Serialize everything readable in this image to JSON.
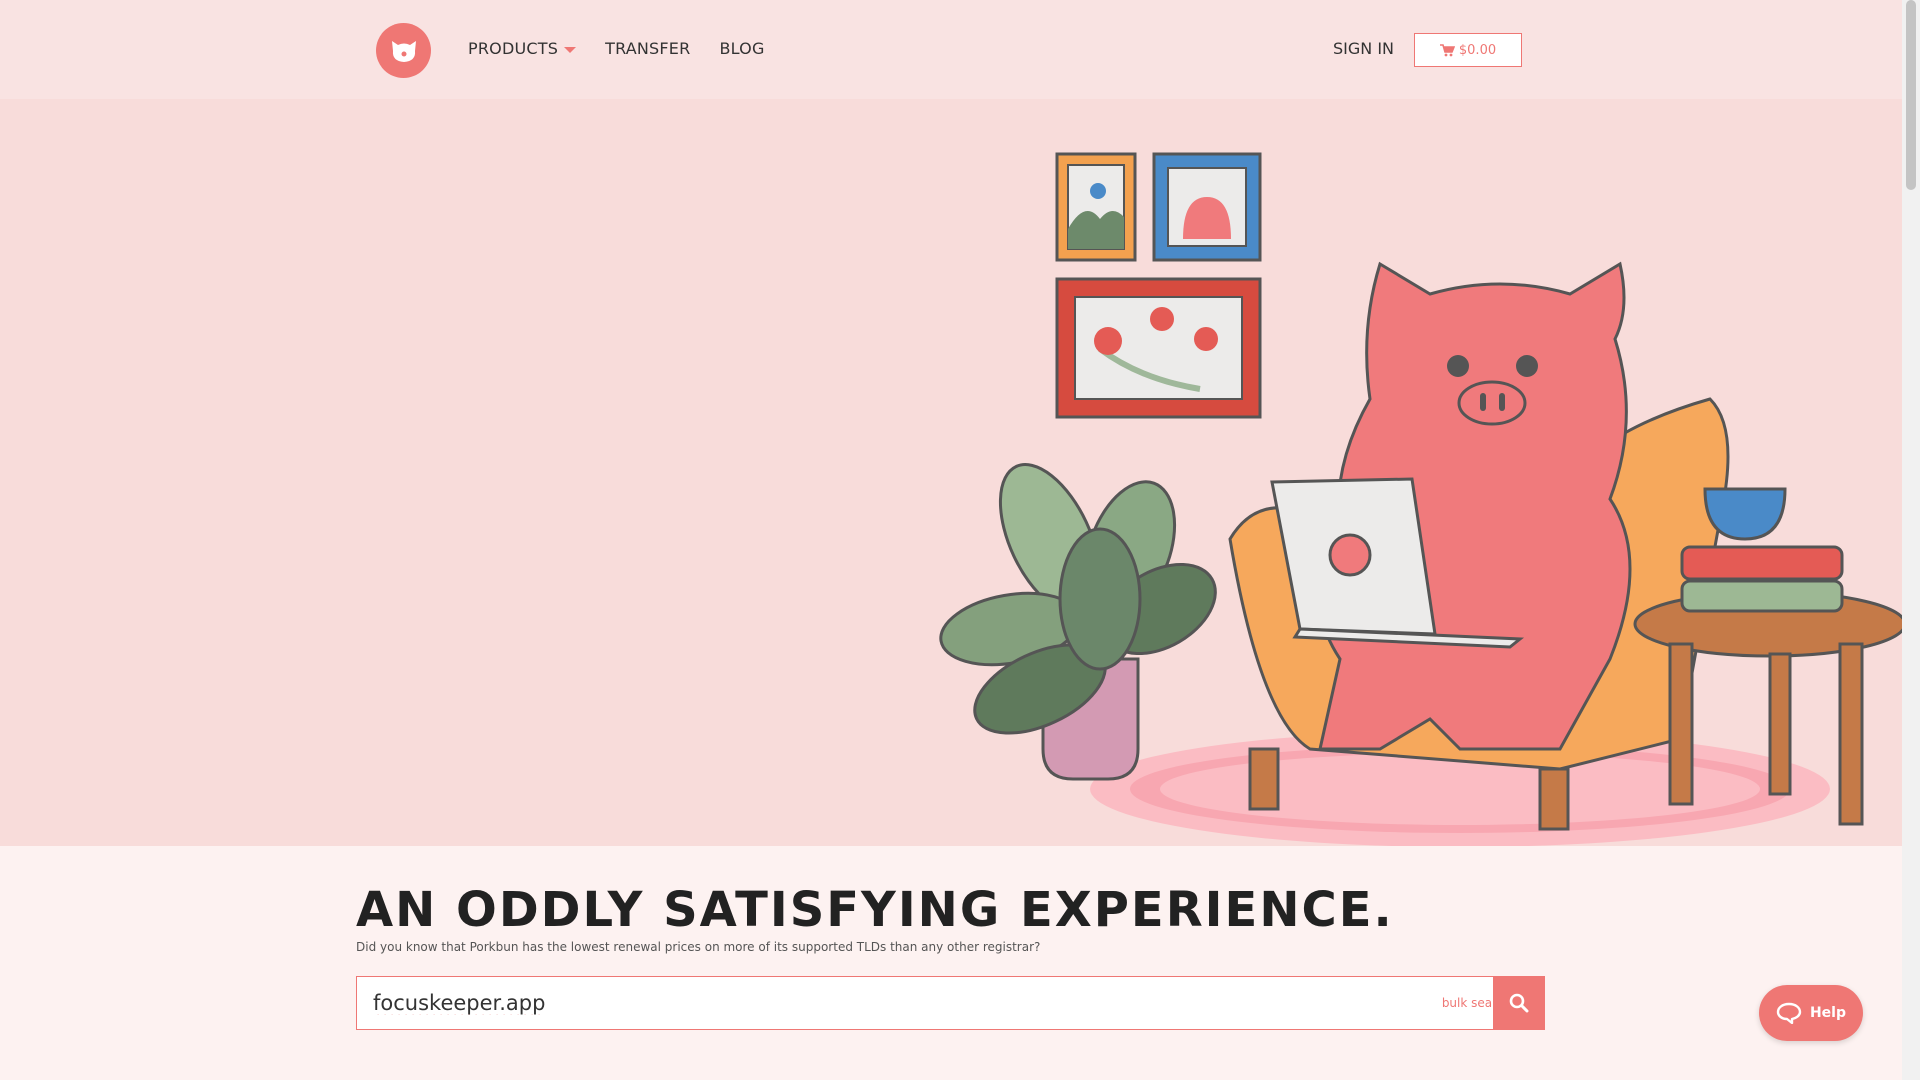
{
  "header": {
    "nav": [
      {
        "label": "PRODUCTS"
      },
      {
        "label": "TRANSFER"
      },
      {
        "label": "BLOG"
      }
    ],
    "sign_in": "SIGN IN",
    "cart_total": "$0.00"
  },
  "main": {
    "headline": "AN ODDLY SATISFYING EXPERIENCE.",
    "subline": "Did you know that Porkbun has the lowest renewal prices on more of its supported TLDs than any other registrar?",
    "search_value": "focuskeeper.app",
    "bulk_search_label": "bulk search"
  },
  "help": {
    "label": "Help"
  },
  "colors": {
    "accent": "#ef7774",
    "header_bg": "#f9e3e2",
    "hero_bg": "#f8dcda",
    "page_bg": "#fdf2f1"
  },
  "icons": [
    "pig-logo-icon",
    "caret-down-icon",
    "cart-icon",
    "search-icon",
    "chat-icon"
  ]
}
